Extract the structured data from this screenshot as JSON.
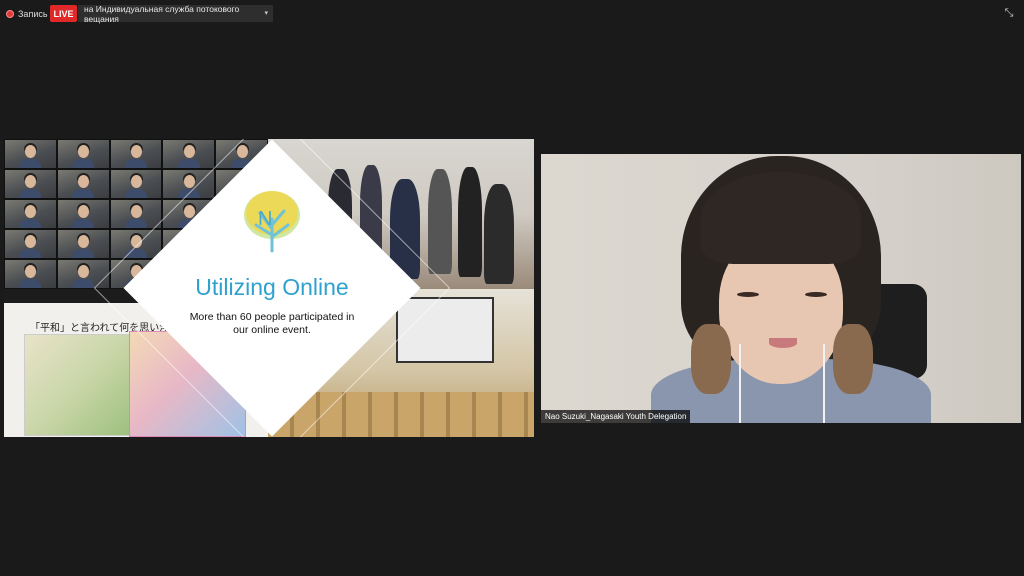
{
  "top_bar": {
    "record_label": "Запись",
    "live_badge": "LIVE",
    "live_target": "на Индивидуальная служба потокового вещания",
    "dropdown_caret": "▾",
    "fullscreen_icon": "⤡"
  },
  "shared_screen": {
    "headline": "Utilizing Online",
    "caption": "More than 60 people participated in our online event.",
    "japanese_prompt": "「平和」と言われて何を思い浮かべま",
    "colors": {
      "headline": "#2ea1cf",
      "logo_tree": "#f2d64b",
      "logo_leaves": "#6fc2d8"
    }
  },
  "speaker": {
    "name": "Nao Suzuki_Nagasaki Youth Delegation"
  },
  "colors": {
    "background": "#1a1a1a",
    "live_red": "#e02828"
  }
}
